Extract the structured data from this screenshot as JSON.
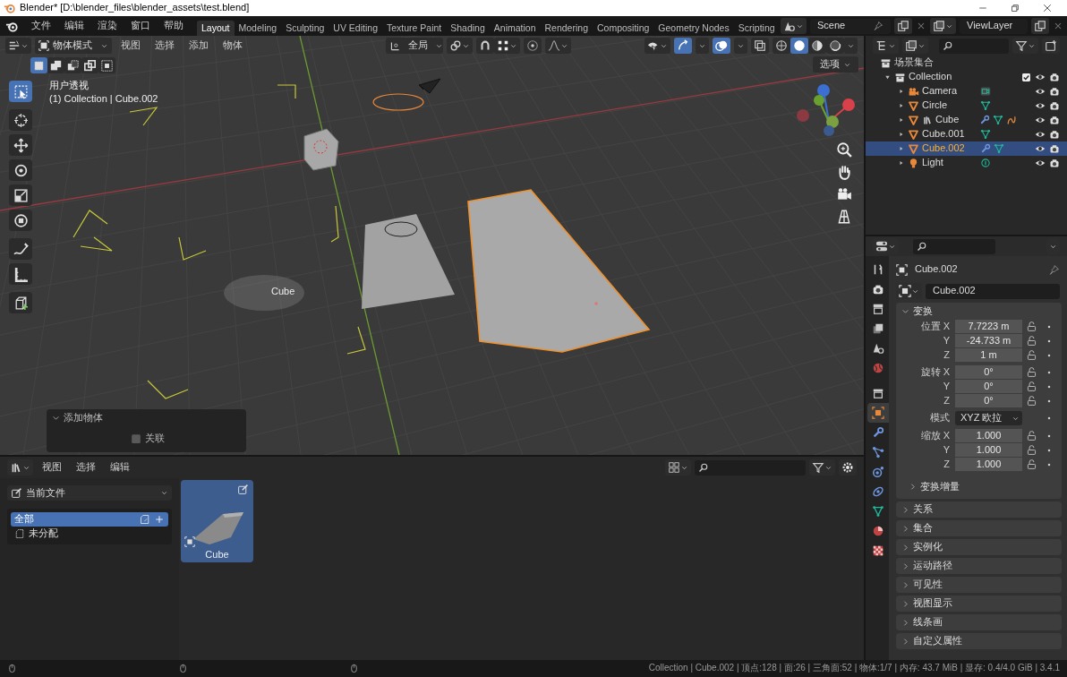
{
  "window": {
    "title": "Blender* [D:\\blender_files\\blender_assets\\test.blend]"
  },
  "menu": [
    "文件",
    "编辑",
    "渲染",
    "窗口",
    "帮助"
  ],
  "workspaces": [
    {
      "label": "Layout",
      "selected": true
    },
    {
      "label": "Modeling",
      "selected": false
    },
    {
      "label": "Sculpting",
      "selected": false
    },
    {
      "label": "UV Editing",
      "selected": false
    },
    {
      "label": "Texture Paint",
      "selected": false
    },
    {
      "label": "Shading",
      "selected": false
    },
    {
      "label": "Animation",
      "selected": false
    },
    {
      "label": "Rendering",
      "selected": false
    },
    {
      "label": "Compositing",
      "selected": false
    },
    {
      "label": "Geometry Nodes",
      "selected": false
    },
    {
      "label": "Scripting",
      "selected": false
    }
  ],
  "scene": "Scene",
  "view_layer": "ViewLayer",
  "viewport": {
    "mode": "物体模式",
    "menus": [
      "视图",
      "选择",
      "添加",
      "物体"
    ],
    "orientation": "全局",
    "options": "选项",
    "view_name": "用户透视",
    "context": "(1) Collection | Cube.002",
    "object_label": "Cube",
    "tools": [
      {
        "kind": "select",
        "selected": true
      },
      {
        "kind": "cursor",
        "selected": false
      },
      {
        "kind": "move",
        "selected": false
      },
      {
        "kind": "rotate",
        "selected": false
      },
      {
        "kind": "scale",
        "selected": false
      },
      {
        "kind": "transform",
        "selected": false
      },
      {
        "kind": "annotate",
        "selected": false
      },
      {
        "kind": "measure",
        "selected": false
      },
      {
        "kind": "add-cube",
        "selected": false
      }
    ],
    "redo_panel": {
      "title": "添加物体",
      "expanded": true,
      "options": [
        {
          "label": "关联",
          "checked": false
        }
      ]
    }
  },
  "outliner": {
    "root": "场景集合",
    "collections": [
      {
        "name": "Collection",
        "checked": true,
        "expanded": true,
        "children": [
          {
            "name": "Camera",
            "kind": "camera",
            "asset": false,
            "data": [
              {
                "kind": "camera-data"
              }
            ],
            "selected": false
          },
          {
            "name": "Circle",
            "kind": "mesh",
            "asset": false,
            "data": [
              {
                "kind": "mesh-data"
              }
            ],
            "selected": false
          },
          {
            "name": "Cube",
            "kind": "mesh",
            "asset": true,
            "data": [
              {
                "kind": "wrench"
              },
              {
                "kind": "mesh-data"
              },
              {
                "kind": "curve"
              }
            ],
            "selected": false
          },
          {
            "name": "Cube.001",
            "kind": "mesh",
            "asset": false,
            "data": [
              {
                "kind": "mesh-data"
              }
            ],
            "selected": false
          },
          {
            "name": "Cube.002",
            "kind": "mesh",
            "asset": false,
            "data": [
              {
                "kind": "wrench"
              },
              {
                "kind": "mesh-data"
              }
            ],
            "selected": true
          },
          {
            "name": "Light",
            "kind": "light",
            "asset": false,
            "data": [
              {
                "kind": "light-data"
              }
            ],
            "selected": false
          }
        ]
      }
    ]
  },
  "properties": {
    "tabs": [
      {
        "kind": "tool",
        "selected": false
      },
      {
        "kind": "render",
        "selected": false
      },
      {
        "kind": "output",
        "selected": false
      },
      {
        "kind": "view-layer",
        "selected": false
      },
      {
        "kind": "scene",
        "selected": false
      },
      {
        "kind": "world",
        "selected": false
      },
      {
        "kind": "collection",
        "selected": false
      },
      {
        "kind": "object",
        "selected": true
      },
      {
        "kind": "modifier",
        "selected": false
      },
      {
        "kind": "particles",
        "selected": false
      },
      {
        "kind": "physics",
        "selected": false
      },
      {
        "kind": "constraints",
        "selected": false
      },
      {
        "kind": "data",
        "selected": false
      },
      {
        "kind": "material",
        "selected": false
      },
      {
        "kind": "texture",
        "selected": false
      }
    ],
    "object_name": "Cube.002",
    "data_name": "Cube.002",
    "transform": {
      "title": "变换",
      "expanded": true,
      "groups": [
        {
          "label": "位置",
          "rows": [
            {
              "axis": "X",
              "value": "7.7223 m"
            },
            {
              "axis": "Y",
              "value": "-24.733 m"
            },
            {
              "axis": "Z",
              "value": "1 m"
            }
          ]
        },
        {
          "label": "旋转",
          "rows": [
            {
              "axis": "X",
              "value": "0°"
            },
            {
              "axis": "Y",
              "value": "0°"
            },
            {
              "axis": "Z",
              "value": "0°"
            }
          ]
        },
        {
          "label": "模式",
          "dropdown": "XYZ 欧拉"
        },
        {
          "label": "缩放",
          "rows": [
            {
              "axis": "X",
              "value": "1.000"
            },
            {
              "axis": "Y",
              "value": "1.000"
            },
            {
              "axis": "Z",
              "value": "1.000"
            }
          ]
        }
      ],
      "subpanel": {
        "title": "变换增量",
        "expanded": false
      }
    },
    "panels": [
      {
        "title": "关系",
        "expanded": false
      },
      {
        "title": "集合",
        "expanded": false
      },
      {
        "title": "实例化",
        "expanded": false
      },
      {
        "title": "运动路径",
        "expanded": false
      },
      {
        "title": "可见性",
        "expanded": false
      },
      {
        "title": "视图显示",
        "expanded": false
      },
      {
        "title": "线条画",
        "expanded": false
      },
      {
        "title": "自定义属性",
        "expanded": false
      }
    ]
  },
  "asset_browser": {
    "menus": [
      "视图",
      "选择",
      "编辑"
    ],
    "library": "当前文件",
    "catalogs": [
      {
        "label": "全部",
        "selected": true
      },
      {
        "label": "未分配",
        "selected": false
      }
    ],
    "assets": [
      {
        "name": "Cube",
        "selected": true
      }
    ]
  },
  "status_bar": {
    "info": "Collection | Cube.002 | 顶点:128 | 面:26 | 三角面:52 | 物体:1/7 | 内存: 43.7 MiB | 显存: 0.4/4.0 GiB | 3.4.1"
  }
}
